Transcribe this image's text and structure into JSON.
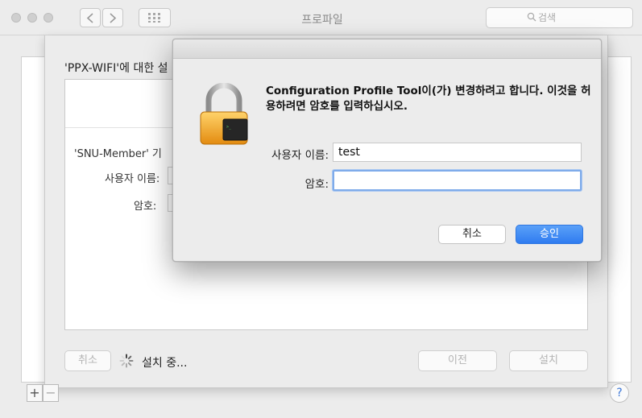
{
  "window": {
    "title": "프로파일",
    "search_placeholder": "검색"
  },
  "sheet": {
    "title": "'PPX-WIFI'에 대한 설",
    "network_label": "'SNU-Member' 기",
    "username_label": "사용자 이름:",
    "password_label": "암호:",
    "cancel_label": "취소",
    "installing_text": "설치 중...",
    "previous_label": "이전",
    "install_label": "설치"
  },
  "footer": {
    "add_label": "+",
    "remove_label": "−",
    "help_label": "?"
  },
  "dialog": {
    "message": "Configuration Profile Tool이(가) 변경하려고 합니다. 이것을 허용하려면 암호를 입력하십시오.",
    "username_label": "사용자 이름:",
    "username_value": "test",
    "password_label": "암호:",
    "password_value": "",
    "cancel_label": "취소",
    "ok_label": "승인"
  },
  "colors": {
    "accent": "#2f7cf0",
    "lock_body": "#f0a824",
    "focus_ring": "#7fabea"
  }
}
